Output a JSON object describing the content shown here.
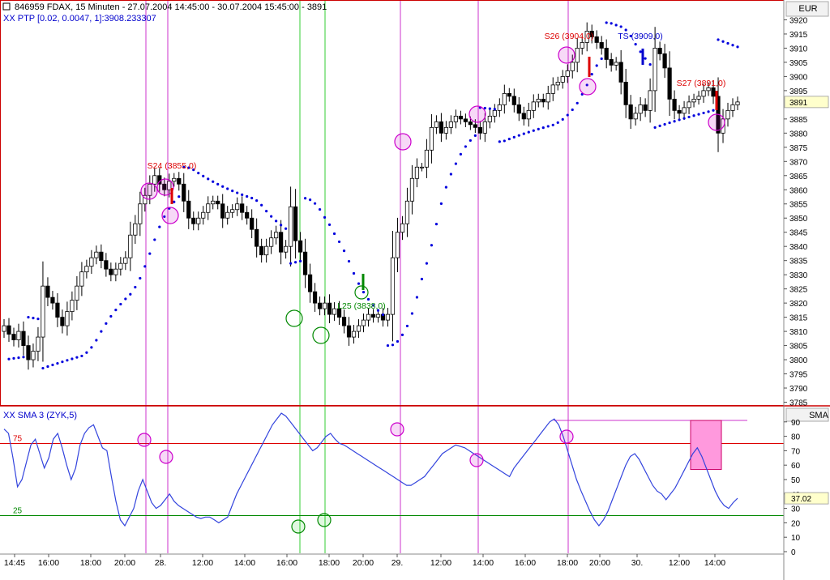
{
  "header": {
    "title": "846959  FDAX, 15 Minuten - 27.07.2004 14:45:00 - 30.07.2004 15:45:00 - 3891",
    "indicator": "XX PTP [0.02, 0.0047, 1]:3908.233307",
    "currency": "EUR",
    "sub_indicator": "XX   SMA 3 (ZYK,5)",
    "sub_axis_label": "SMA"
  },
  "colors": {
    "candle": "#000000",
    "sar": "#0000dd",
    "short_signal": "#dd0000",
    "long_signal": "#008800",
    "circle": "#cc00cc",
    "oscillator": "#3344dd",
    "vline_magenta": "#cc33cc",
    "vline_green": "#33cc33",
    "level75": "#dd0000",
    "level25": "#008800",
    "frame": "#cc0000",
    "box": "#ff99dd"
  },
  "chart_data": [
    {
      "type": "candlestick",
      "xlabel": "",
      "ylabel": "",
      "x_ticks": [
        "14:45",
        "16:00",
        "18:00",
        "20:00",
        "28.",
        "12:00",
        "14:00",
        "16:00",
        "18:00",
        "20:00",
        "29.",
        "12:00",
        "14:00",
        "16:00",
        "18:00",
        "20:00",
        "30.",
        "12:00",
        "14:00"
      ],
      "y_ticks": [
        3920,
        3915,
        3910,
        3905,
        3900,
        3895,
        3885,
        3880,
        3875,
        3870,
        3865,
        3860,
        3855,
        3850,
        3845,
        3840,
        3835,
        3830,
        3825,
        3820,
        3815,
        3810,
        3805,
        3800,
        3795,
        3790,
        3785
      ],
      "ylim": [
        3784,
        3927
      ],
      "last_price": "3891",
      "bar_count": 152,
      "closes": [
        3812,
        3809,
        3807,
        3810,
        3805,
        3800,
        3803,
        3808,
        3826,
        3822,
        3820,
        3815,
        3812,
        3817,
        3821,
        3826,
        3831,
        3833,
        3836,
        3838,
        3835,
        3832,
        3830,
        3832,
        3834,
        3836,
        3844,
        3848,
        3855,
        3858,
        3862,
        3865,
        3862,
        3860,
        3863,
        3864,
        3862,
        3856,
        3850,
        3848,
        3850,
        3852,
        3855,
        3856,
        3855,
        3850,
        3852,
        3853,
        3855,
        3852,
        3850,
        3846,
        3840,
        3837,
        3840,
        3843,
        3845,
        3838,
        3840,
        3854,
        3842,
        3838,
        3830,
        3824,
        3820,
        3818,
        3820,
        3816,
        3818,
        3815,
        3812,
        3808,
        3810,
        3812,
        3814,
        3816,
        3815,
        3816,
        3814,
        3816,
        3836,
        3845,
        3848,
        3856,
        3864,
        3868,
        3868,
        3874,
        3882,
        3884,
        3880,
        3882,
        3884,
        3886,
        3885,
        3884,
        3883,
        3882,
        3880,
        3884,
        3886,
        3888,
        3890,
        3894,
        3893,
        3890,
        3887,
        3885,
        3888,
        3891,
        3892,
        3891,
        3894,
        3897,
        3898,
        3900,
        3902,
        3905,
        3910,
        3912,
        3916,
        3914,
        3912,
        3910,
        3906,
        3904,
        3905,
        3898,
        3890,
        3885,
        3887,
        3890,
        3888,
        3895,
        3910,
        3908,
        3903,
        3892,
        3888,
        3887,
        3889,
        3891,
        3892,
        3893,
        3895,
        3896,
        3893,
        3880,
        3885,
        3888,
        3890,
        3891
      ],
      "markers": [
        {
          "label": "S24 (3855,0)",
          "value": 3855,
          "side": "short"
        },
        {
          "label": "L25 (3838,0)",
          "value": 3838,
          "side": "long"
        },
        {
          "label": "S26 (3904,0)",
          "value": 3904,
          "side": "short"
        },
        {
          "label": "TS (3909,0)",
          "value": 3909,
          "side": "stop"
        },
        {
          "label": "S27 (3891,0)",
          "value": 3891,
          "side": "short"
        }
      ]
    },
    {
      "type": "line",
      "name": "SMA 3 (ZYK,5)",
      "y_ticks": [
        90,
        80,
        70,
        60,
        50,
        40,
        30,
        20,
        10,
        0
      ],
      "ylim": [
        0,
        100
      ],
      "current_value": "37.02",
      "levels": [
        {
          "label": "75",
          "value": 75
        },
        {
          "label": "25",
          "value": 25
        }
      ],
      "values": [
        85,
        82,
        65,
        45,
        50,
        62,
        74,
        78,
        68,
        58,
        65,
        78,
        82,
        72,
        60,
        50,
        58,
        74,
        82,
        86,
        88,
        80,
        72,
        70,
        52,
        35,
        22,
        18,
        24,
        30,
        42,
        50,
        42,
        34,
        30,
        32,
        36,
        40,
        35,
        32,
        30,
        28,
        26,
        24,
        23,
        24,
        24,
        22,
        20,
        22,
        24,
        32,
        40,
        46,
        52,
        58,
        64,
        70,
        76,
        82,
        88,
        92,
        96,
        94,
        90,
        86,
        82,
        78,
        74,
        70,
        72,
        76,
        80,
        82,
        78,
        75,
        74,
        72,
        70,
        68,
        66,
        64,
        62,
        60,
        58,
        56,
        54,
        52,
        50,
        48,
        46,
        46,
        48,
        50,
        52,
        56,
        60,
        64,
        68,
        70,
        72,
        74,
        73,
        72,
        70,
        68,
        66,
        64,
        62,
        60,
        58,
        56,
        54,
        52,
        58,
        62,
        66,
        70,
        74,
        78,
        82,
        86,
        90,
        92,
        88,
        80,
        70,
        60,
        50,
        42,
        35,
        28,
        22,
        18,
        22,
        28,
        36,
        44,
        52,
        60,
        66,
        68,
        64,
        58,
        52,
        46,
        42,
        40,
        36,
        40,
        44,
        50,
        56,
        62,
        68,
        72,
        66,
        58,
        50,
        42,
        36,
        32,
        30,
        34,
        37
      ]
    }
  ]
}
